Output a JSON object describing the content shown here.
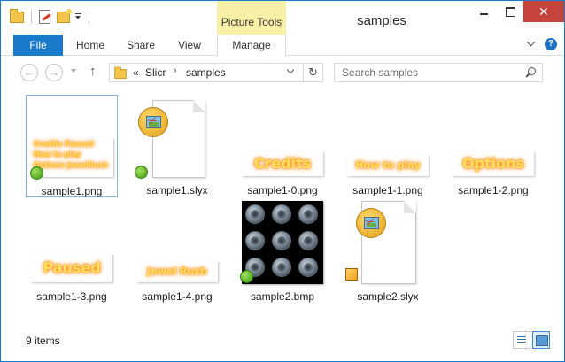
{
  "window": {
    "title": "samples",
    "context_tab_group": "Picture Tools",
    "close_glyph": "✕"
  },
  "ribbon": {
    "tabs": [
      {
        "id": "file",
        "label": "File"
      },
      {
        "id": "home",
        "label": "Home"
      },
      {
        "id": "share",
        "label": "Share"
      },
      {
        "id": "view",
        "label": "View"
      },
      {
        "id": "manage",
        "label": "Manage"
      }
    ],
    "help_glyph": "?"
  },
  "address": {
    "overflow_glyph": "«",
    "separator_glyph": "›",
    "crumbs": [
      "Slicr",
      "samples"
    ],
    "back_glyph": "←",
    "forward_glyph": "→",
    "up_glyph": "↑",
    "refresh_glyph": "↻"
  },
  "search": {
    "placeholder": "Search samples"
  },
  "files": [
    {
      "name": "sample1.png",
      "kind": "png-multi",
      "badge": "green",
      "selected": true,
      "thumb_lines": [
        "Credits Paused",
        "How to play",
        "Options JewelRush"
      ]
    },
    {
      "name": "sample1.slyx",
      "kind": "slyx",
      "badge": "green"
    },
    {
      "name": "sample1-0.png",
      "kind": "png",
      "thumb_text": "Credits"
    },
    {
      "name": "sample1-1.png",
      "kind": "png",
      "thumb_text": "How to play"
    },
    {
      "name": "sample1-2.png",
      "kind": "png",
      "thumb_text": "Options"
    },
    {
      "name": "sample1-3.png",
      "kind": "png",
      "thumb_text": "Paused"
    },
    {
      "name": "sample1-4.png",
      "kind": "png",
      "thumb_text": "Jewel Rush"
    },
    {
      "name": "sample2.bmp",
      "kind": "bmp",
      "badge": "green"
    },
    {
      "name": "sample2.slyx",
      "kind": "slyx",
      "badge": "orange"
    }
  ],
  "status": {
    "count": "9 items"
  },
  "colors": {
    "accent": "#1979ca",
    "picture_tools": "#f7f0a6",
    "close_button": "#c7443c",
    "badge_green": "#3f9a14",
    "badge_orange": "#f0a21e"
  },
  "icons": {
    "qat": [
      "folder-icon",
      "properties-icon",
      "new-folder-icon",
      "customize-dropdown-icon"
    ],
    "status_views": [
      "details-view-icon",
      "large-icons-icon"
    ]
  }
}
